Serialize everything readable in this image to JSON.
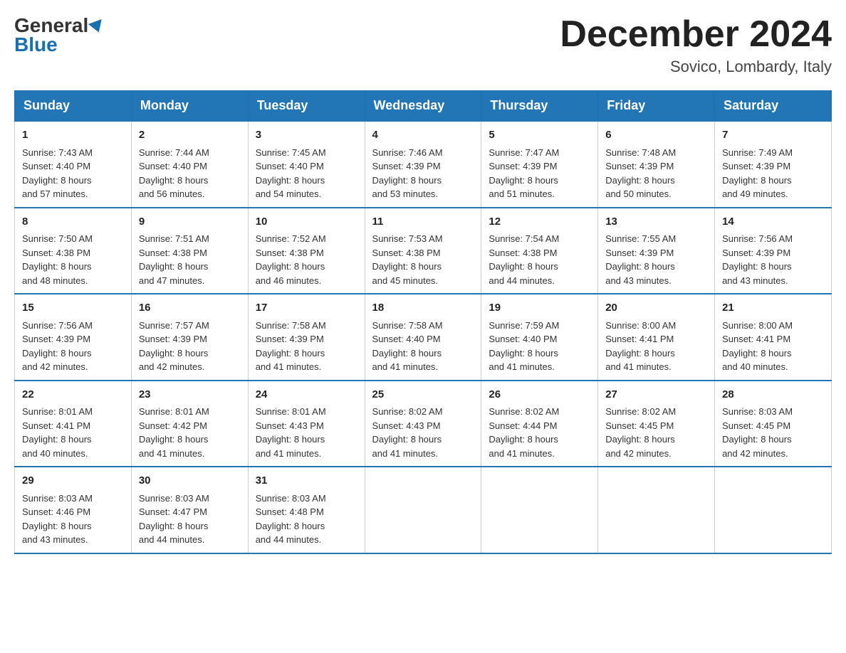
{
  "header": {
    "logo_general": "General",
    "logo_blue": "Blue",
    "month_title": "December 2024",
    "location": "Sovico, Lombardy, Italy"
  },
  "weekdays": [
    "Sunday",
    "Monday",
    "Tuesday",
    "Wednesday",
    "Thursday",
    "Friday",
    "Saturday"
  ],
  "weeks": [
    [
      {
        "day": "1",
        "sunrise": "7:43 AM",
        "sunset": "4:40 PM",
        "daylight": "8 hours and 57 minutes."
      },
      {
        "day": "2",
        "sunrise": "7:44 AM",
        "sunset": "4:40 PM",
        "daylight": "8 hours and 56 minutes."
      },
      {
        "day": "3",
        "sunrise": "7:45 AM",
        "sunset": "4:40 PM",
        "daylight": "8 hours and 54 minutes."
      },
      {
        "day": "4",
        "sunrise": "7:46 AM",
        "sunset": "4:39 PM",
        "daylight": "8 hours and 53 minutes."
      },
      {
        "day": "5",
        "sunrise": "7:47 AM",
        "sunset": "4:39 PM",
        "daylight": "8 hours and 51 minutes."
      },
      {
        "day": "6",
        "sunrise": "7:48 AM",
        "sunset": "4:39 PM",
        "daylight": "8 hours and 50 minutes."
      },
      {
        "day": "7",
        "sunrise": "7:49 AM",
        "sunset": "4:39 PM",
        "daylight": "8 hours and 49 minutes."
      }
    ],
    [
      {
        "day": "8",
        "sunrise": "7:50 AM",
        "sunset": "4:38 PM",
        "daylight": "8 hours and 48 minutes."
      },
      {
        "day": "9",
        "sunrise": "7:51 AM",
        "sunset": "4:38 PM",
        "daylight": "8 hours and 47 minutes."
      },
      {
        "day": "10",
        "sunrise": "7:52 AM",
        "sunset": "4:38 PM",
        "daylight": "8 hours and 46 minutes."
      },
      {
        "day": "11",
        "sunrise": "7:53 AM",
        "sunset": "4:38 PM",
        "daylight": "8 hours and 45 minutes."
      },
      {
        "day": "12",
        "sunrise": "7:54 AM",
        "sunset": "4:38 PM",
        "daylight": "8 hours and 44 minutes."
      },
      {
        "day": "13",
        "sunrise": "7:55 AM",
        "sunset": "4:39 PM",
        "daylight": "8 hours and 43 minutes."
      },
      {
        "day": "14",
        "sunrise": "7:56 AM",
        "sunset": "4:39 PM",
        "daylight": "8 hours and 43 minutes."
      }
    ],
    [
      {
        "day": "15",
        "sunrise": "7:56 AM",
        "sunset": "4:39 PM",
        "daylight": "8 hours and 42 minutes."
      },
      {
        "day": "16",
        "sunrise": "7:57 AM",
        "sunset": "4:39 PM",
        "daylight": "8 hours and 42 minutes."
      },
      {
        "day": "17",
        "sunrise": "7:58 AM",
        "sunset": "4:39 PM",
        "daylight": "8 hours and 41 minutes."
      },
      {
        "day": "18",
        "sunrise": "7:58 AM",
        "sunset": "4:40 PM",
        "daylight": "8 hours and 41 minutes."
      },
      {
        "day": "19",
        "sunrise": "7:59 AM",
        "sunset": "4:40 PM",
        "daylight": "8 hours and 41 minutes."
      },
      {
        "day": "20",
        "sunrise": "8:00 AM",
        "sunset": "4:41 PM",
        "daylight": "8 hours and 41 minutes."
      },
      {
        "day": "21",
        "sunrise": "8:00 AM",
        "sunset": "4:41 PM",
        "daylight": "8 hours and 40 minutes."
      }
    ],
    [
      {
        "day": "22",
        "sunrise": "8:01 AM",
        "sunset": "4:41 PM",
        "daylight": "8 hours and 40 minutes."
      },
      {
        "day": "23",
        "sunrise": "8:01 AM",
        "sunset": "4:42 PM",
        "daylight": "8 hours and 41 minutes."
      },
      {
        "day": "24",
        "sunrise": "8:01 AM",
        "sunset": "4:43 PM",
        "daylight": "8 hours and 41 minutes."
      },
      {
        "day": "25",
        "sunrise": "8:02 AM",
        "sunset": "4:43 PM",
        "daylight": "8 hours and 41 minutes."
      },
      {
        "day": "26",
        "sunrise": "8:02 AM",
        "sunset": "4:44 PM",
        "daylight": "8 hours and 41 minutes."
      },
      {
        "day": "27",
        "sunrise": "8:02 AM",
        "sunset": "4:45 PM",
        "daylight": "8 hours and 42 minutes."
      },
      {
        "day": "28",
        "sunrise": "8:03 AM",
        "sunset": "4:45 PM",
        "daylight": "8 hours and 42 minutes."
      }
    ],
    [
      {
        "day": "29",
        "sunrise": "8:03 AM",
        "sunset": "4:46 PM",
        "daylight": "8 hours and 43 minutes."
      },
      {
        "day": "30",
        "sunrise": "8:03 AM",
        "sunset": "4:47 PM",
        "daylight": "8 hours and 44 minutes."
      },
      {
        "day": "31",
        "sunrise": "8:03 AM",
        "sunset": "4:48 PM",
        "daylight": "8 hours and 44 minutes."
      },
      null,
      null,
      null,
      null
    ]
  ],
  "labels": {
    "sunrise": "Sunrise:",
    "sunset": "Sunset:",
    "daylight": "Daylight:"
  }
}
